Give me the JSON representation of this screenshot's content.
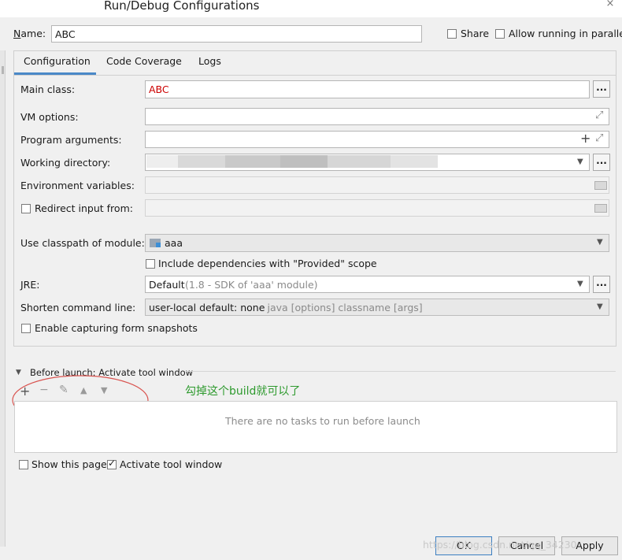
{
  "window": {
    "title": "Run/Debug Configurations",
    "close_glyph": "×"
  },
  "name_row": {
    "label": "Name:",
    "value": "ABC",
    "share_label": "Share",
    "parallel_label": "Allow running in parallel"
  },
  "tabs": [
    {
      "label": "Configuration",
      "selected": true
    },
    {
      "label": "Code Coverage",
      "selected": false
    },
    {
      "label": "Logs",
      "selected": false
    }
  ],
  "config": {
    "main_class_label": "Main class:",
    "main_class_value": "ABC",
    "main_class_color": "#cc0000",
    "vm_options_label": "VM options:",
    "program_args_label": "Program arguments:",
    "working_dir_label": "Working directory:",
    "env_vars_label": "Environment variables:",
    "redirect_label": "Redirect input from:",
    "classpath_label": "Use classpath of module:",
    "classpath_value": "aaa",
    "include_deps_label": "Include dependencies with \"Provided\" scope",
    "jre_label": "JRE:",
    "jre_value": "Default",
    "jre_hint": "(1.8 - SDK of 'aaa' module)",
    "shorten_label": "Shorten command line:",
    "shorten_value": "user-local default: none",
    "shorten_hint": "- java [options] classname [args]",
    "snapshots_label": "Enable capturing form snapshots",
    "dots": "..."
  },
  "before_launch": {
    "label": "Before launch: Activate tool window",
    "annotation": "勾掉这个build就可以了",
    "annotation_color": "#2e9a2e",
    "empty_text": "There are no tasks to run before launch",
    "toolbar_glyphs": {
      "add": "+",
      "remove": "−",
      "edit": "✎",
      "up": "▲",
      "down": "▼"
    }
  },
  "footer": {
    "show_page_label": "Show this page",
    "activate_label": "Activate tool window",
    "ok_label": "OK",
    "cancel_label": "Cancel",
    "apply_label": "Apply",
    "watermark": "https://blog.csdn.net/qq_34230"
  },
  "colors": {
    "accent": "#4a88c7",
    "circle": "#d9534f"
  }
}
